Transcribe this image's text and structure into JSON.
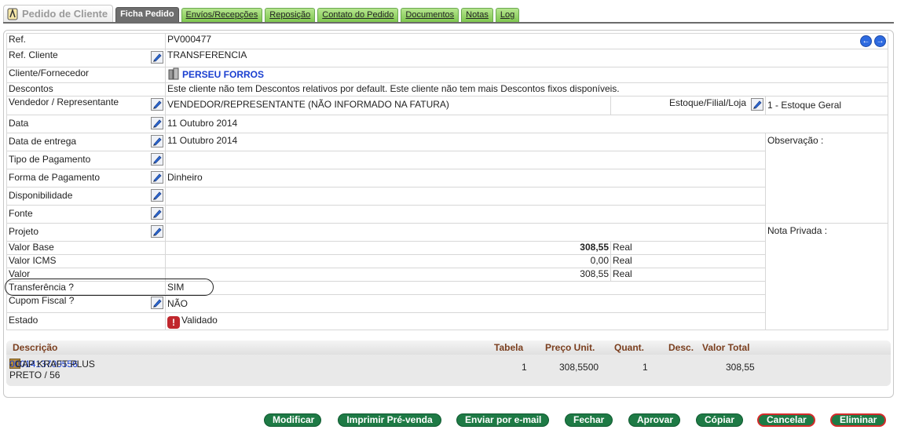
{
  "tabs": {
    "main_label": "Pedido de Cliente",
    "items": [
      {
        "label": "Ficha Pedido",
        "active": true
      },
      {
        "label": "Envíos/Recepções"
      },
      {
        "label": "Reposição"
      },
      {
        "label": "Contato do Pedido"
      },
      {
        "label": "Documentos"
      },
      {
        "label": "Notas"
      },
      {
        "label": "Log"
      }
    ]
  },
  "form": {
    "ref_label": "Ref.",
    "ref_value": "PV000477",
    "ref_cliente_label": "Ref. Cliente",
    "ref_cliente_value": "TRANSFERENCIA",
    "cliente_label": "Cliente/Fornecedor",
    "cliente_value": "PERSEU FORROS",
    "descontos_label": "Descontos",
    "descontos_value": "Este cliente não tem Descontos relativos por default. Este cliente não tem mais Descontos fixos disponíveis.",
    "vendedor_label": "Vendedor / Representante",
    "vendedor_value": "VENDEDOR/REPRESENTANTE (NÃO INFORMADO NA FATURA)",
    "estoque_label": "Estoque/Filial/Loja",
    "estoque_value": "1 - Estoque Geral",
    "data_label": "Data",
    "data_value": "11 Outubro 2014",
    "data_entrega_label": "Data de entrega",
    "data_entrega_value": "11 Outubro 2014",
    "observacao_label": "Observação :",
    "tipo_pagamento_label": "Tipo de Pagamento",
    "forma_pagamento_label": "Forma de Pagamento",
    "forma_pagamento_value": "Dinheiro",
    "disponibilidade_label": "Disponibilidade",
    "fonte_label": "Fonte",
    "projeto_label": "Projeto",
    "nota_privada_label": "Nota Privada :",
    "valor_base_label": "Valor Base",
    "valor_base_value": "308,55",
    "valor_icms_label": "Valor ICMS",
    "valor_icms_value": "0,00",
    "valor_label": "Valor",
    "valor_value": "308,55",
    "currency": "Real",
    "transferencia_label": "Transferência ?",
    "transferencia_value": "SIM",
    "cupom_label": "Cupom Fiscal ?",
    "cupom_value": "NÃO",
    "estado_label": "Estado",
    "estado_value": "Validado"
  },
  "lines": {
    "headers": {
      "descricao": "Descrição",
      "tabela": "Tabela",
      "preco_unit": "Preço Unit.",
      "quant": "Quant.",
      "desc": "Desc.",
      "valor_total": "Valor Total"
    },
    "rows": [
      {
        "code": "0001413700556",
        "name": " - CAP KRAFT PLUS",
        "variant": "PRETO / 56",
        "tabela": "1",
        "preco_unit": "308,5500",
        "quant": "1",
        "valor_total": "308,55"
      }
    ]
  },
  "buttons": {
    "modificar": "Modificar",
    "imprimir": "Imprimir Pré-venda",
    "enviar": "Enviar por e-mail",
    "fechar": "Fechar",
    "aprovar": "Aprovar",
    "copiar": "Cópiar",
    "cancelar": "Cancelar",
    "eliminar": "Eliminar"
  }
}
